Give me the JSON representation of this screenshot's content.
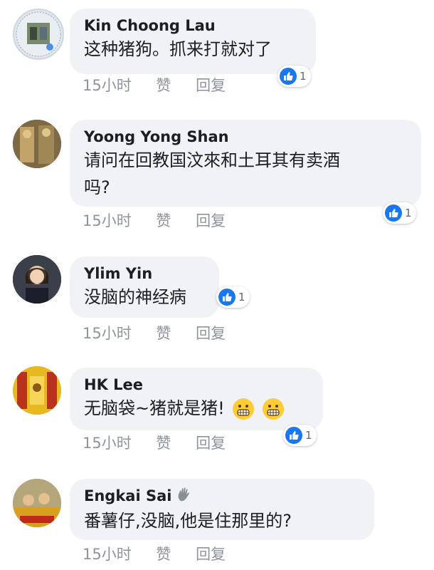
{
  "comments": [
    {
      "author": "Kin Choong Lau",
      "text": "这种猪狗。抓来打就对了",
      "time": "15小时",
      "like_label": "赞",
      "reply_label": "回复",
      "reactions": "1"
    },
    {
      "author": "Yoong Yong Shan",
      "text_line1": "请问在回教国汶來和土耳其有卖酒",
      "text_line2": "吗?",
      "time": "15小时",
      "like_label": "赞",
      "reply_label": "回复",
      "reactions": "1"
    },
    {
      "author": "Ylim Yin",
      "text": "没脑的神经病",
      "time": "15小时",
      "like_label": "赞",
      "reply_label": "回复",
      "reactions": "1"
    },
    {
      "author": "HK Lee",
      "text": "无脑袋~猪就是猪!",
      "emoji": [
        "grimacing-emoji",
        "grimacing-emoji"
      ],
      "time": "15小时",
      "like_label": "赞",
      "reply_label": "回复",
      "reactions": "1"
    },
    {
      "author": "Engkai Sai",
      "author_badge_icon": "waving-hand-icon",
      "text": "番薯仔,没脑,他是住那里的?",
      "time": "15小时",
      "like_label": "赞",
      "reply_label": "回复"
    }
  ],
  "colors": {
    "bubble": "#f0f2f5",
    "like_blue": "#1877f2",
    "meta_gray": "#8d949e",
    "emoji_yellow": "#ffcc33"
  }
}
